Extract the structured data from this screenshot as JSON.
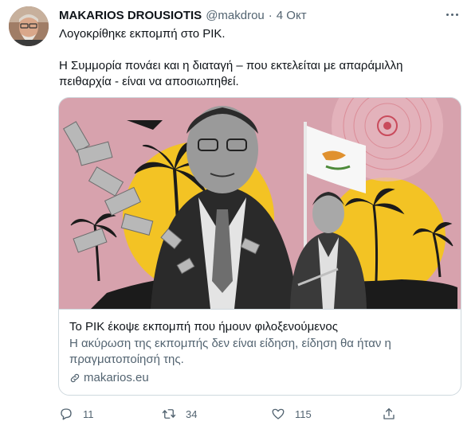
{
  "tweet": {
    "author_name": "MAKARIOS DROUSIOTIS",
    "handle": "@makdrou",
    "separator": "·",
    "time": "4 Окт",
    "text_line1": "Λογοκρίθηκε εκπομπή στο ΡΙΚ.",
    "text_line2": "Η Συμμορία πονάει και η διαταγή – που εκτελείται με απαράμιλλη πειθαρχία - είναι να αποσιωπηθεί."
  },
  "card": {
    "title": "Το ΡΙΚ έκοψε εκπομπή που ήμουν φιλοξενούμενος",
    "description": "Η ακύρωση της εκπομπής δεν είναι είδηση, είδηση θα ήταν η πραγματοποίησή της.",
    "domain": "makarios.eu"
  },
  "actions": {
    "replies": "11",
    "retweets": "34",
    "likes": "115"
  },
  "colors": {
    "text_primary": "#0f1419",
    "text_secondary": "#536471",
    "border": "#cfd9de",
    "media_background": "#d7a2ad",
    "sun": "#f3c324"
  },
  "icons": [
    "more-icon",
    "reply-icon",
    "retweet-icon",
    "like-icon",
    "share-icon",
    "link-icon"
  ]
}
